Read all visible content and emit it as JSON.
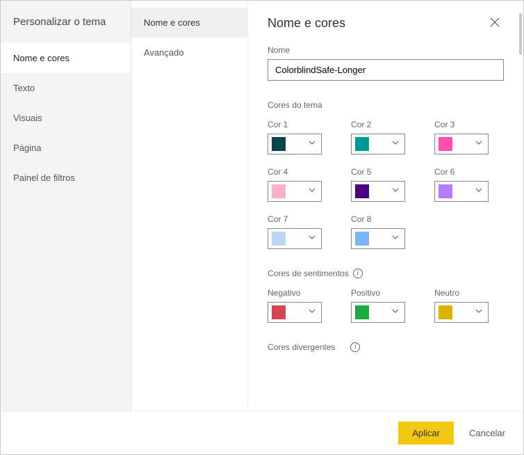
{
  "dialog_title": "Personalizar o tema",
  "sidebar_left": {
    "items": [
      {
        "label": "Nome e cores",
        "active": true
      },
      {
        "label": "Texto"
      },
      {
        "label": "Visuais"
      },
      {
        "label": "Página"
      },
      {
        "label": "Painel de filtros"
      }
    ]
  },
  "sidebar_mid": {
    "items": [
      {
        "label": "Nome e cores",
        "active": true
      },
      {
        "label": "Avançado"
      }
    ]
  },
  "content": {
    "heading": "Nome e cores",
    "name_label": "Nome",
    "name_value": "ColorblindSafe-Longer",
    "theme_colors_label": "Cores do tema",
    "theme_colors": [
      {
        "label": "Cor 1",
        "hex": "#074650"
      },
      {
        "label": "Cor 2",
        "hex": "#009999"
      },
      {
        "label": "Cor 3",
        "hex": "#ff4fb0"
      },
      {
        "label": "Cor 4",
        "hex": "#fdb0cb"
      },
      {
        "label": "Cor 5",
        "hex": "#4b0082"
      },
      {
        "label": "Cor 6",
        "hex": "#b47cff"
      },
      {
        "label": "Cor 7",
        "hex": "#bcd7f5"
      },
      {
        "label": "Cor 8",
        "hex": "#7ab5f8"
      }
    ],
    "sentiment_label": "Cores de sentimentos",
    "sentiment_colors": [
      {
        "label": "Negativo",
        "hex": "#d64550"
      },
      {
        "label": "Positivo",
        "hex": "#1aab40"
      },
      {
        "label": "Neutro",
        "hex": "#d9b300"
      }
    ],
    "divergent_label": "Cores divergentes"
  },
  "footer": {
    "apply": "Aplicar",
    "cancel": "Cancelar"
  }
}
